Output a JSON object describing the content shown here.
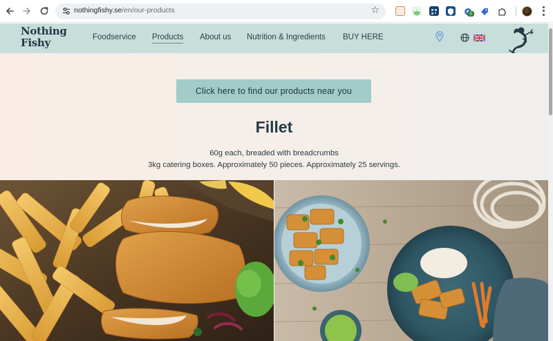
{
  "browser": {
    "url_host": "nothingfishy.se",
    "url_path": "/en/our-products",
    "icons": [
      "back-icon",
      "forward-icon",
      "reload-icon",
      "site-info-icon",
      "bookmark-star-icon",
      "extensions-icon",
      "menu-icon"
    ],
    "extension_badge": "0"
  },
  "site": {
    "logo_line1": "Nothing",
    "logo_line2": "Fishy",
    "nav": [
      "Foodservice",
      "Products",
      "About us",
      "Nutrition & Ingredients",
      "BUY HERE"
    ],
    "active_nav": "Products",
    "language": "English"
  },
  "hero": {
    "cta_label": "Click here to find our products near you",
    "title": "Fillet",
    "desc_line1": "60g each, breaded with breadcrumbs",
    "desc_line2": "3kg catering boxes. Approximately 50 pieces. Approximately 25 servings."
  },
  "colors": {
    "header_bg": "#c7dedb",
    "cta_bg": "#a3cbc7",
    "title_color": "#253b45"
  }
}
